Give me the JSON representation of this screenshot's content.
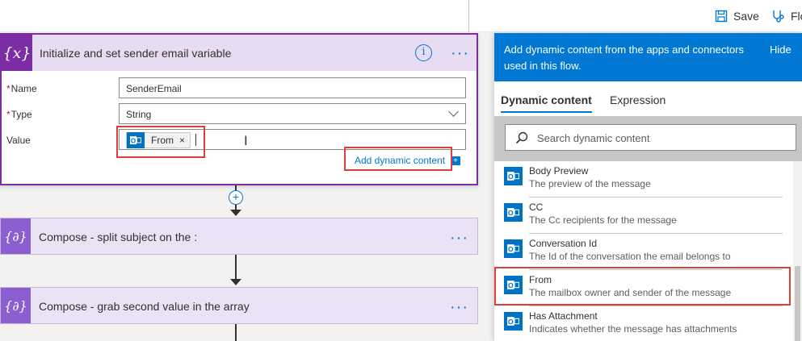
{
  "toolbar": {
    "save_label": "Save",
    "flow_checker_label": "Flo"
  },
  "init_card": {
    "title": "Initialize and set sender email variable",
    "name_label": "Name",
    "name_value": "SenderEmail",
    "type_label": "Type",
    "type_value": "String",
    "value_label": "Value",
    "token_label": "From",
    "token_remove": "×",
    "add_dynamic_label": "Add dynamic content",
    "required_mark": "*",
    "var_glyph": "{x}",
    "info_glyph": "i",
    "more_glyph": "···"
  },
  "compose_cards": [
    {
      "title": "Compose - split subject on the :",
      "more_glyph": "···"
    },
    {
      "title": "Compose - grab second value in the array",
      "more_glyph": "···"
    }
  ],
  "add_step_glyph": "+",
  "dynamic_panel": {
    "header_text": "Add dynamic content from the apps and connectors used in this flow.",
    "hide_label": "Hide",
    "tabs": [
      "Dynamic content",
      "Expression"
    ],
    "search_placeholder": "Search dynamic content",
    "items": [
      {
        "name": "Body Preview",
        "desc": "The preview of the message"
      },
      {
        "name": "CC",
        "desc": "The Cc recipients for the message"
      },
      {
        "name": "Conversation Id",
        "desc": "The Id of the conversation the email belongs to"
      },
      {
        "name": "From",
        "desc": "The mailbox owner and sender of the message"
      },
      {
        "name": "Has Attachment",
        "desc": "Indicates whether the message has attachments"
      }
    ]
  },
  "colors": {
    "accent": "#0078d4",
    "variable_purple": "#7c2da6",
    "compose_purple": "#8c5fd0",
    "outlook_blue": "#0072c6",
    "highlight_red": "#e03c3c"
  },
  "icons": [
    "save-icon",
    "flow-checker-icon",
    "variable-icon",
    "info-icon",
    "more-icon",
    "compose-icon",
    "outlook-icon",
    "search-icon",
    "add-step-icon"
  ]
}
